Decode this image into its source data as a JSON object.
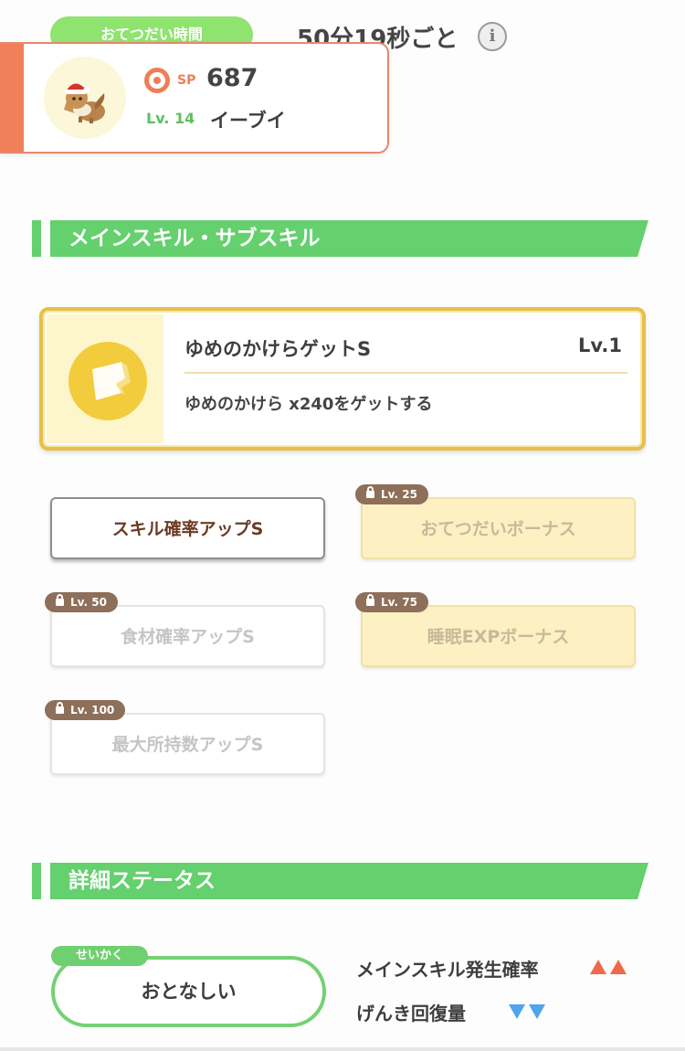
{
  "help": {
    "label": "おてつだい時間",
    "time": "50分19秒ごと",
    "info_glyph": "i"
  },
  "pokemon": {
    "sp_label": "SP",
    "sp_value": "687",
    "level_label": "Lv. 14",
    "name": "イーブイ"
  },
  "sections": {
    "skills_title": "メインスキル・サブスキル",
    "status_title": "詳細ステータス"
  },
  "main_skill": {
    "name": "ゆめのかけらゲットS",
    "level": "Lv.1",
    "description": "ゆめのかけら x240をゲットする"
  },
  "sub_skills": [
    {
      "label": "スキル確率アップS",
      "lock": "",
      "style": "active"
    },
    {
      "label": "おてつだいボーナス",
      "lock": "Lv. 25",
      "style": "gold"
    },
    {
      "label": "食材確率アップS",
      "lock": "Lv. 50",
      "style": "white"
    },
    {
      "label": "睡眠EXPボーナス",
      "lock": "Lv. 75",
      "style": "gold"
    },
    {
      "label": "最大所持数アップS",
      "lock": "Lv. 100",
      "style": "white"
    }
  ],
  "nature": {
    "badge": "せいかく",
    "name": "おとなしい",
    "effects": [
      {
        "label": "メインスキル発生確率",
        "direction": "up",
        "count": 2,
        "color": "#ee6a4a"
      },
      {
        "label": "げんき回復量",
        "direction": "down",
        "count": 2,
        "color": "#4fa3ef"
      }
    ]
  },
  "colors": {
    "accent_green": "#64d06e",
    "accent_orange": "#ef8059",
    "gold": "#e6c04a"
  }
}
